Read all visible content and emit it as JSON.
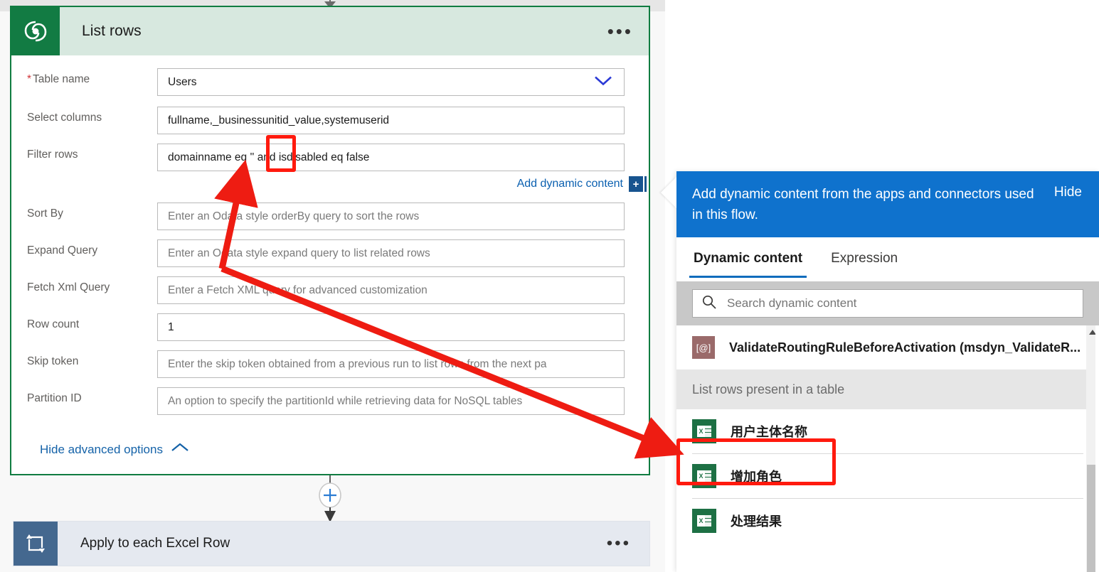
{
  "card": {
    "title": "List rows",
    "icon": "dataverse-icon",
    "menu": "•••",
    "hide_advanced": "Hide advanced options",
    "dynamic_link": "Add dynamic content",
    "dynamic_plus": "+",
    "fields": [
      {
        "label": "Table name",
        "required": true,
        "value": "Users",
        "placeholder": "",
        "is_placeholder": false,
        "dropdown": true
      },
      {
        "label": "Select columns",
        "required": false,
        "value": "fullname,_businessunitid_value,systemuserid",
        "placeholder": "",
        "is_placeholder": false,
        "dropdown": false
      },
      {
        "label": "Filter rows",
        "required": false,
        "value": "domainname eq '' and isdisabled eq false",
        "placeholder": "",
        "is_placeholder": false,
        "dropdown": false
      },
      {
        "label": "Sort By",
        "required": false,
        "value": "Enter an Odata style orderBy query to sort the rows",
        "placeholder": "Enter an Odata style orderBy query to sort the rows",
        "is_placeholder": true,
        "dropdown": false
      },
      {
        "label": "Expand Query",
        "required": false,
        "value": "Enter an Odata style expand query to list related rows",
        "placeholder": "Enter an Odata style expand query to list related rows",
        "is_placeholder": true,
        "dropdown": false
      },
      {
        "label": "Fetch Xml Query",
        "required": false,
        "value": "Enter a Fetch XML query for advanced customization",
        "placeholder": "Enter a Fetch XML query for advanced customization",
        "is_placeholder": true,
        "dropdown": false
      },
      {
        "label": "Row count",
        "required": false,
        "value": "1",
        "placeholder": "",
        "is_placeholder": false,
        "dropdown": false
      },
      {
        "label": "Skip token",
        "required": false,
        "value": "Enter the skip token obtained from a previous run to list rows from the next pa",
        "placeholder": "Enter the skip token obtained from a previous run to list rows from the next pa",
        "is_placeholder": true,
        "dropdown": false
      },
      {
        "label": "Partition ID",
        "required": false,
        "value": "An option to specify the partitionId while retrieving data for NoSQL tables",
        "placeholder": "An option to specify the partitionId while retrieving data for NoSQL tables",
        "is_placeholder": true,
        "dropdown": false
      }
    ]
  },
  "next_card": {
    "title": "Apply to each Excel Row",
    "icon": "loop-icon",
    "menu": "•••"
  },
  "dynamic_panel": {
    "banner_text": "Add dynamic content from the apps and connectors used in this flow.",
    "hide_label": "Hide",
    "tabs": [
      {
        "label": "Dynamic content",
        "active": true
      },
      {
        "label": "Expression",
        "active": false
      }
    ],
    "search": {
      "placeholder": "Search dynamic content",
      "value": ""
    },
    "entries": [
      {
        "type": "item",
        "icon": "at-badge-icon",
        "label": "ValidateRoutingRuleBeforeActivation (msdyn_ValidateR..."
      },
      {
        "type": "group",
        "label": "List rows present in a table"
      },
      {
        "type": "item",
        "icon": "excel-icon",
        "label": "用户主体名称",
        "highlighted": true
      },
      {
        "type": "item",
        "icon": "excel-icon",
        "label": "增加角色"
      },
      {
        "type": "item",
        "icon": "excel-icon",
        "label": "处理结果"
      }
    ],
    "scrollbar": {
      "up_arrow": "▲"
    }
  },
  "colors": {
    "connector_green": "#107c41",
    "header_green_bg": "#d7e8df",
    "icon_green": "#127b43",
    "banner_blue": "#0f72cd",
    "annotation_red": "#ff1a0e",
    "loop_blue": "#44688f",
    "link_blue": "#0b60b0"
  }
}
